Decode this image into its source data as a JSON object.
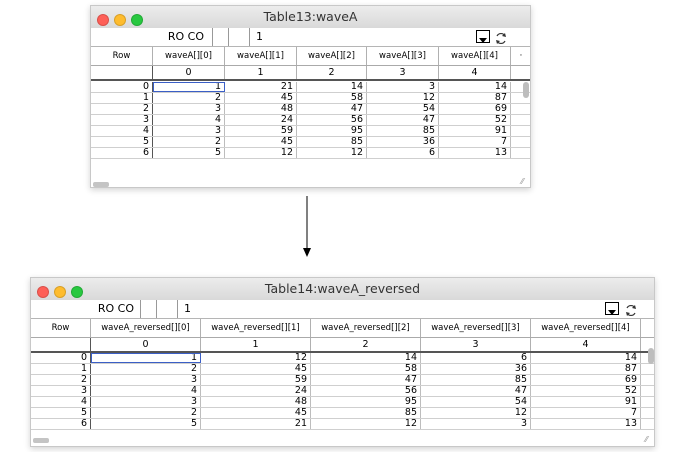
{
  "colors": {
    "close": "#fe5f57",
    "minimize": "#febc2e",
    "zoom": "#28c840",
    "selection": "#3b5fc6"
  },
  "arrow": {
    "icon": "down-arrow-icon"
  },
  "windows": [
    {
      "title": "Table13:waveA",
      "toolbar": {
        "cell_ref": "RO CO",
        "value": "1",
        "dropdown_icon": "dropdown-icon",
        "refresh_icon": "refresh-icon"
      },
      "corner_label": "Row",
      "columns": [
        "waveA[][0]",
        "waveA[][1]",
        "waveA[][2]",
        "waveA[][3]",
        "waveA[][4]"
      ],
      "column_indices": [
        "0",
        "1",
        "2",
        "3",
        "4"
      ],
      "overflow_marker": "·",
      "rows": [
        {
          "label": "0",
          "cells": [
            "1",
            "21",
            "14",
            "3",
            "14"
          ]
        },
        {
          "label": "1",
          "cells": [
            "2",
            "45",
            "58",
            "12",
            "87"
          ]
        },
        {
          "label": "2",
          "cells": [
            "3",
            "48",
            "47",
            "54",
            "69"
          ]
        },
        {
          "label": "3",
          "cells": [
            "4",
            "24",
            "56",
            "47",
            "52"
          ]
        },
        {
          "label": "4",
          "cells": [
            "3",
            "59",
            "95",
            "85",
            "91"
          ]
        },
        {
          "label": "5",
          "cells": [
            "2",
            "45",
            "85",
            "36",
            "7"
          ]
        },
        {
          "label": "6",
          "cells": [
            "5",
            "12",
            "12",
            "6",
            "13"
          ]
        }
      ]
    },
    {
      "title": "Table14:waveA_reversed",
      "toolbar": {
        "cell_ref": "RO CO",
        "value": "1",
        "dropdown_icon": "dropdown-icon",
        "refresh_icon": "refresh-icon"
      },
      "corner_label": "Row",
      "columns": [
        "waveA_reversed[][0]",
        "waveA_reversed[][1]",
        "waveA_reversed[][2]",
        "waveA_reversed[][3]",
        "waveA_reversed[][4]"
      ],
      "column_indices": [
        "0",
        "1",
        "2",
        "3",
        "4"
      ],
      "rows": [
        {
          "label": "0",
          "cells": [
            "1",
            "12",
            "14",
            "6",
            "14"
          ]
        },
        {
          "label": "1",
          "cells": [
            "2",
            "45",
            "58",
            "36",
            "87"
          ]
        },
        {
          "label": "2",
          "cells": [
            "3",
            "59",
            "47",
            "85",
            "69"
          ]
        },
        {
          "label": "3",
          "cells": [
            "4",
            "24",
            "56",
            "47",
            "52"
          ]
        },
        {
          "label": "4",
          "cells": [
            "3",
            "48",
            "95",
            "54",
            "91"
          ]
        },
        {
          "label": "5",
          "cells": [
            "2",
            "45",
            "85",
            "12",
            "7"
          ]
        },
        {
          "label": "6",
          "cells": [
            "5",
            "21",
            "12",
            "3",
            "13"
          ]
        }
      ]
    }
  ]
}
